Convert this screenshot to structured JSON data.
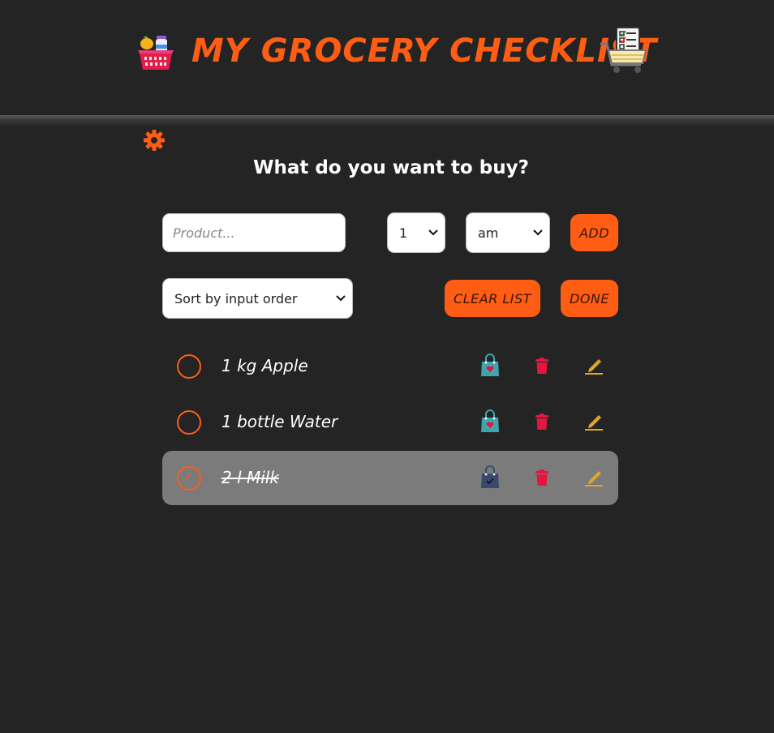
{
  "header": {
    "title": "MY GROCERY CHECKLIST",
    "left_icon": "grocery-basket-icon",
    "right_icon": "shopping-cart-checklist-icon",
    "accent_color": "#ff5d14"
  },
  "settings": {
    "icon": "gear-icon"
  },
  "prompt": "What do you want to buy?",
  "form": {
    "product_placeholder": "Product...",
    "product_value": "",
    "quantity_value": "1",
    "unit_value": "am",
    "add_label": "ADD"
  },
  "controls": {
    "sort_value": "Sort by input order",
    "clear_label": "CLEAR LIST",
    "done_label": "DONE"
  },
  "items": [
    {
      "label": "1 kg Apple",
      "checked": false,
      "bag_icon": "shopping-bag-heart-icon",
      "delete_icon": "trash-icon",
      "edit_icon": "pencil-icon"
    },
    {
      "label": "1 bottle Water",
      "checked": false,
      "bag_icon": "shopping-bag-heart-icon",
      "delete_icon": "trash-icon",
      "edit_icon": "pencil-icon"
    },
    {
      "label": "2 l Milk",
      "checked": true,
      "bag_icon": "shopping-bag-check-icon",
      "delete_icon": "trash-icon",
      "edit_icon": "pencil-icon"
    }
  ],
  "colors": {
    "background": "#242424",
    "accent": "#ff5d14",
    "done_row": "#7b7b7b",
    "trash": "#e3163f",
    "pencil": "#e0a52a",
    "bag_teal": "#3fa6ad"
  }
}
